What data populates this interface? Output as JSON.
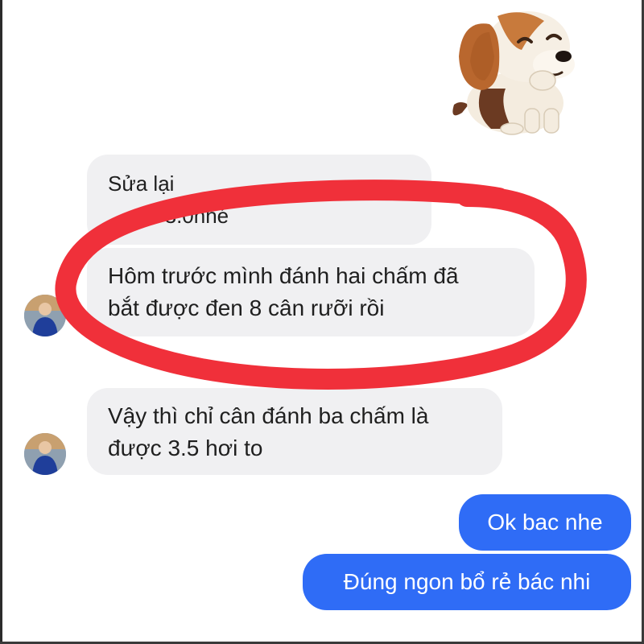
{
  "messages": [
    {
      "id": "m1",
      "direction": "incoming",
      "lines": [
        "Sửa lại",
        "anh 3.0nhé"
      ],
      "partially_obscured": true
    },
    {
      "id": "m2",
      "direction": "incoming",
      "lines": [
        "Hôm trước mình đánh hai chấm đã",
        "bắt được đen 8 cân rưỡi rồi"
      ],
      "highlighted": true
    },
    {
      "id": "m3",
      "direction": "incoming",
      "lines": [
        "Vậy thì chỉ cân đánh ba chấm là",
        "được 3.5 hơi to"
      ]
    },
    {
      "id": "m4",
      "direction": "outgoing",
      "text": "Ok bac nhe"
    },
    {
      "id": "m5",
      "direction": "outgoing",
      "text": "Đúng ngon bổ rẻ bác nhi"
    }
  ],
  "sticker": {
    "icon": "winking-puppy-sticker-icon"
  },
  "annotation": {
    "shape": "hand-drawn ellipse",
    "color": "#f0303a"
  },
  "colors": {
    "incoming_bubble": "#f0f0f2",
    "outgoing_bubble": "#2f6cf6",
    "incoming_text": "#1f1f1f",
    "outgoing_text": "#ffffff",
    "background": "#ffffff"
  }
}
